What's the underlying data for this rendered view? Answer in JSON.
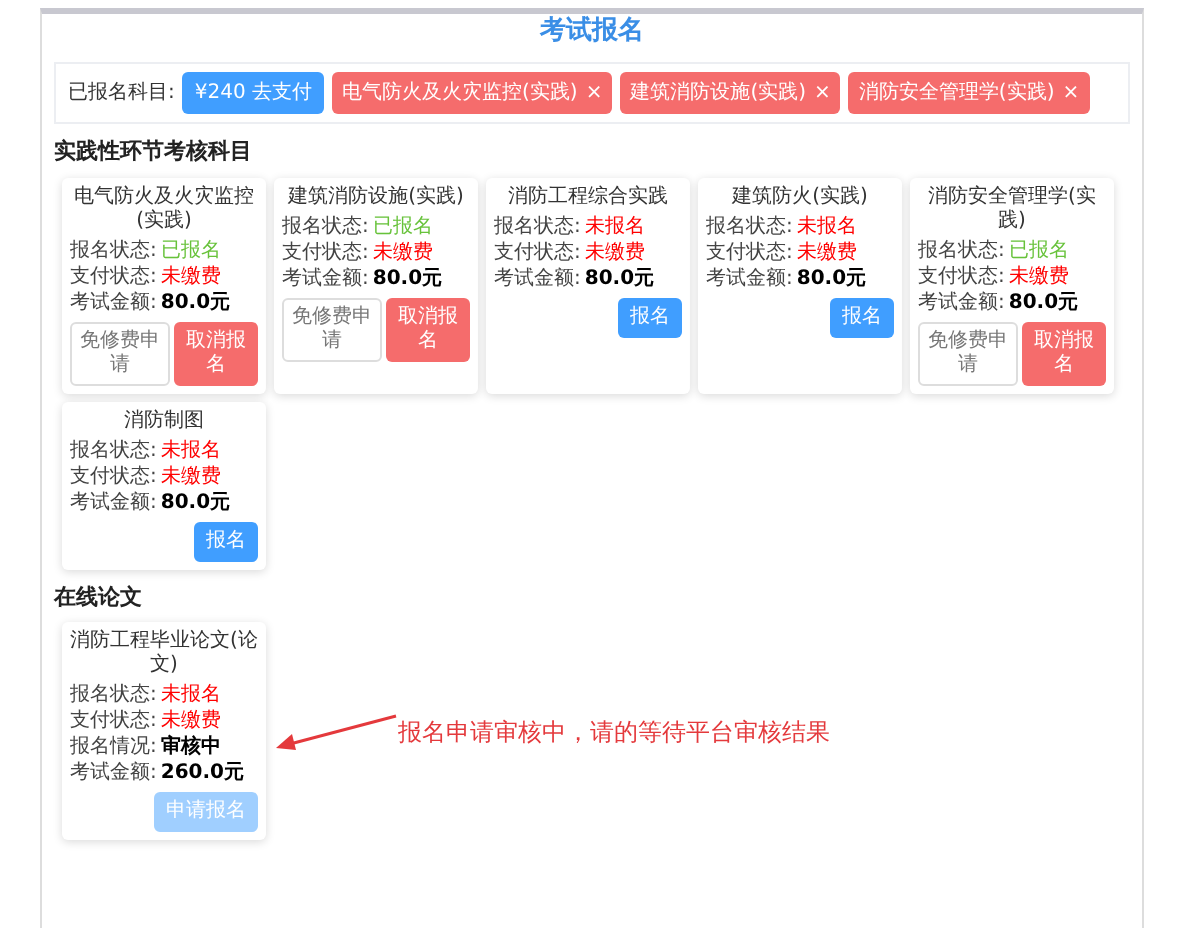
{
  "page_title": "考试报名",
  "registered": {
    "label": "已报名科目:",
    "pay_button": "¥240 去支付",
    "tags": [
      {
        "text": "电气防火及火灾监控(实践)",
        "close": "×"
      },
      {
        "text": "建筑消防设施(实践)",
        "close": "×"
      },
      {
        "text": "消防安全管理学(实践)",
        "close": "×"
      }
    ]
  },
  "sections": [
    {
      "heading": "实践性环节考核科目",
      "cards": [
        {
          "title": "电气防火及火灾监控(实践)",
          "lines": [
            {
              "label": "报名状态:",
              "value": "已报名",
              "kind": "ok"
            },
            {
              "label": "支付状态:",
              "value": "未缴费",
              "kind": "warn"
            },
            {
              "label": "考试金额:",
              "value": "80.0元",
              "kind": "plain"
            }
          ],
          "buttons": [
            {
              "text": "免修费申请",
              "kind": "outline"
            },
            {
              "text": "取消报名",
              "kind": "danger"
            }
          ]
        },
        {
          "title": "建筑消防设施(实践)",
          "lines": [
            {
              "label": "报名状态:",
              "value": "已报名",
              "kind": "ok"
            },
            {
              "label": "支付状态:",
              "value": "未缴费",
              "kind": "warn"
            },
            {
              "label": "考试金额:",
              "value": "80.0元",
              "kind": "plain"
            }
          ],
          "buttons": [
            {
              "text": "免修费申请",
              "kind": "outline"
            },
            {
              "text": "取消报名",
              "kind": "danger"
            }
          ]
        },
        {
          "title": "消防工程综合实践",
          "lines": [
            {
              "label": "报名状态:",
              "value": "未报名",
              "kind": "warn"
            },
            {
              "label": "支付状态:",
              "value": "未缴费",
              "kind": "warn"
            },
            {
              "label": "考试金额:",
              "value": "80.0元",
              "kind": "plain"
            }
          ],
          "buttons": [
            {
              "text": "报名",
              "kind": "primary"
            }
          ]
        },
        {
          "title": "建筑防火(实践)",
          "lines": [
            {
              "label": "报名状态:",
              "value": "未报名",
              "kind": "warn"
            },
            {
              "label": "支付状态:",
              "value": "未缴费",
              "kind": "warn"
            },
            {
              "label": "考试金额:",
              "value": "80.0元",
              "kind": "plain"
            }
          ],
          "buttons": [
            {
              "text": "报名",
              "kind": "primary"
            }
          ]
        },
        {
          "title": "消防安全管理学(实践)",
          "lines": [
            {
              "label": "报名状态:",
              "value": "已报名",
              "kind": "ok"
            },
            {
              "label": "支付状态:",
              "value": "未缴费",
              "kind": "warn"
            },
            {
              "label": "考试金额:",
              "value": "80.0元",
              "kind": "plain"
            }
          ],
          "buttons": [
            {
              "text": "免修费申请",
              "kind": "outline"
            },
            {
              "text": "取消报名",
              "kind": "danger"
            }
          ]
        },
        {
          "title": "消防制图",
          "lines": [
            {
              "label": "报名状态:",
              "value": "未报名",
              "kind": "warn"
            },
            {
              "label": "支付状态:",
              "value": "未缴费",
              "kind": "warn"
            },
            {
              "label": "考试金额:",
              "value": "80.0元",
              "kind": "plain"
            }
          ],
          "buttons": [
            {
              "text": "报名",
              "kind": "primary"
            }
          ]
        }
      ]
    },
    {
      "heading": "在线论文",
      "cards": [
        {
          "title": "消防工程毕业论文(论文)",
          "lines": [
            {
              "label": "报名状态:",
              "value": "未报名",
              "kind": "warn"
            },
            {
              "label": "支付状态:",
              "value": "未缴费",
              "kind": "warn"
            },
            {
              "label": "报名情况:",
              "value": "审核中",
              "kind": "plain"
            },
            {
              "label": "考试金额:",
              "value": "260.0元",
              "kind": "plain"
            }
          ],
          "buttons": [
            {
              "text": "申请报名",
              "kind": "disabled"
            }
          ]
        }
      ]
    }
  ],
  "annotation": {
    "text": "报名申请审核中，请的等待平台审核结果"
  }
}
